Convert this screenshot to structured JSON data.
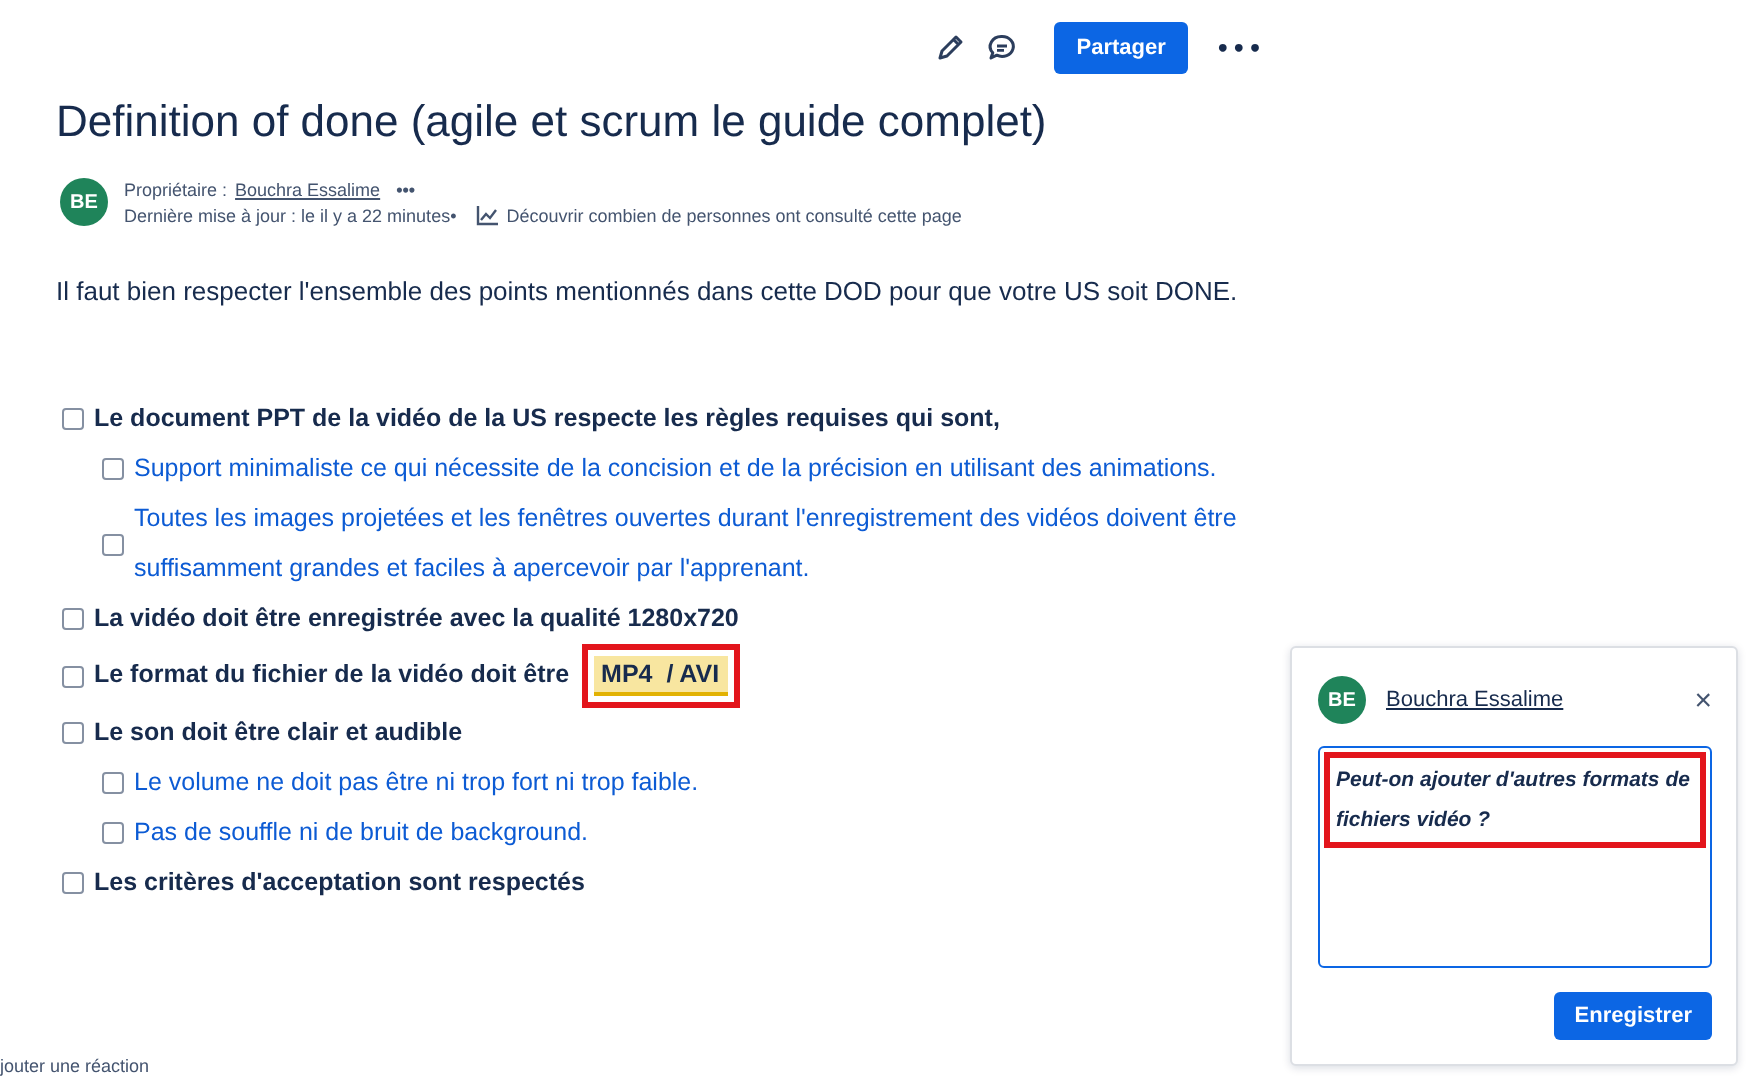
{
  "toolbar": {
    "share_button": "Partager",
    "more": "•••"
  },
  "title": "Definition of done (agile et scrum le guide complet)",
  "byline": {
    "avatar": "BE",
    "owner_label": "Propriétaire :",
    "owner": "Bouchra Essalime",
    "more": "•••",
    "updated": "Dernière mise à jour : le il y a 22 minutes•",
    "analytics": "Découvrir combien de personnes ont consulté cette page"
  },
  "intro": "Il faut bien respecter l'ensemble des points mentionnés dans cette DOD pour que votre US soit DONE.",
  "checklist": [
    {
      "text": "Le document PPT de la vidéo de la US respecte les règles requises qui sont,",
      "checked": false,
      "children": [
        {
          "text": "Support minimaliste ce qui nécessite de la concision et de la précision en utilisant des animations.",
          "checked": false
        },
        {
          "text": "Toutes les images projetées et les fenêtres ouvertes durant l'enregistrement des vidéos doivent être suffisamment grandes et faciles à apercevoir par l'apprenant.",
          "checked": false
        }
      ]
    },
    {
      "text": "La vidéo doit être enregistrée avec la qualité 1280x720",
      "checked": false
    },
    {
      "text": "Le format du fichier de la vidéo doit être",
      "checked": false,
      "highlight": {
        "text": "MP4  / AVI",
        "annotated": true
      }
    },
    {
      "text": "Le son doit être clair et audible",
      "checked": false,
      "children": [
        {
          "text": "Le volume ne doit pas être ni trop fort ni trop faible.",
          "checked": false
        },
        {
          "text": "Pas de souffle ni de bruit de background.",
          "checked": false
        }
      ]
    },
    {
      "text": "Les critères d'acceptation sont respectés",
      "checked": false
    }
  ],
  "reaction_link": "jouter une réaction",
  "comment_panel": {
    "avatar": "BE",
    "author": "Bouchra Essalime",
    "close": "×",
    "value": "Peut-on ajouter d'autres formats de fichiers vidéo ?",
    "annotated": true,
    "save_button": "Enregistrer"
  }
}
